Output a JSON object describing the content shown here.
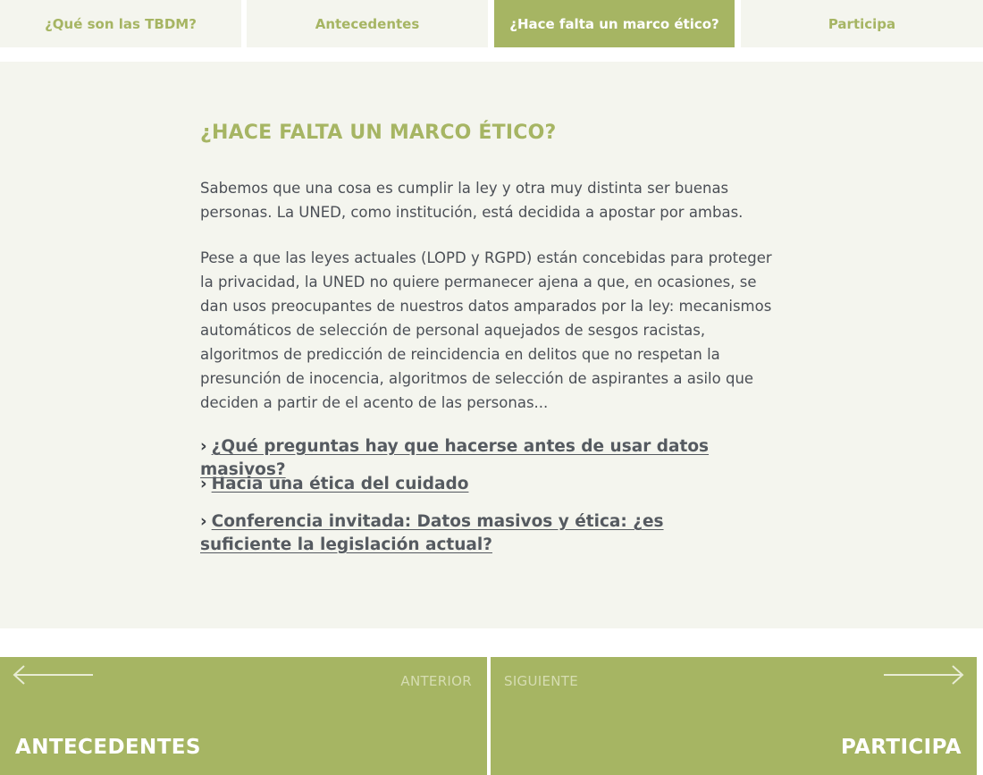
{
  "tabs": [
    {
      "label": "¿Qué son las TBDM?",
      "active": false
    },
    {
      "label": "Antecedentes",
      "active": false
    },
    {
      "label": "¿Hace falta un marco ético?",
      "active": true
    },
    {
      "label": "Participa",
      "active": false
    }
  ],
  "section": {
    "title": "¿HACE FALTA UN MARCO ÉTICO?",
    "paragraphs": [
      "Sabemos que una cosa es cumplir la ley y otra muy distinta ser buenas personas. La UNED, como institución, está decidida a apostar por ambas.",
      "Pese a que las leyes actuales (LOPD y RGPD) están concebidas para proteger la privacidad, la UNED no quiere permanecer ajena a que, en ocasiones, se dan usos preocupantes de nuestros datos amparados por la ley: mecanismos automáticos de selección de personal aquejados de sesgos racistas, algoritmos de predicción de reincidencia en delitos que no respetan la presunción de inocencia, algoritmos de selección de aspirantes a asilo que deciden a partir de el acento de las personas..."
    ],
    "links": [
      {
        "chevron": "›",
        "label": "¿Qué preguntas hay que hacerse antes de usar datos masivos?"
      },
      {
        "chevron": "›",
        "label": "Hacia una ética del cuidado"
      },
      {
        "chevron": "›",
        "label": "Conferencia invitada: Datos masivos y ética: ¿es suficiente la legislación actual?"
      }
    ]
  },
  "pager": {
    "prev": {
      "kicker": "ANTERIOR",
      "title": "ANTECEDENTES",
      "icon": "arrow-left-icon"
    },
    "next": {
      "kicker": "SIGUIENTE",
      "title": "PARTICIPA",
      "icon": "arrow-right-icon"
    }
  },
  "colors": {
    "accent": "#a6b563",
    "panel_bg": "#f4f5ee",
    "body_text": "#4b4f56",
    "link_text": "#555a60"
  }
}
